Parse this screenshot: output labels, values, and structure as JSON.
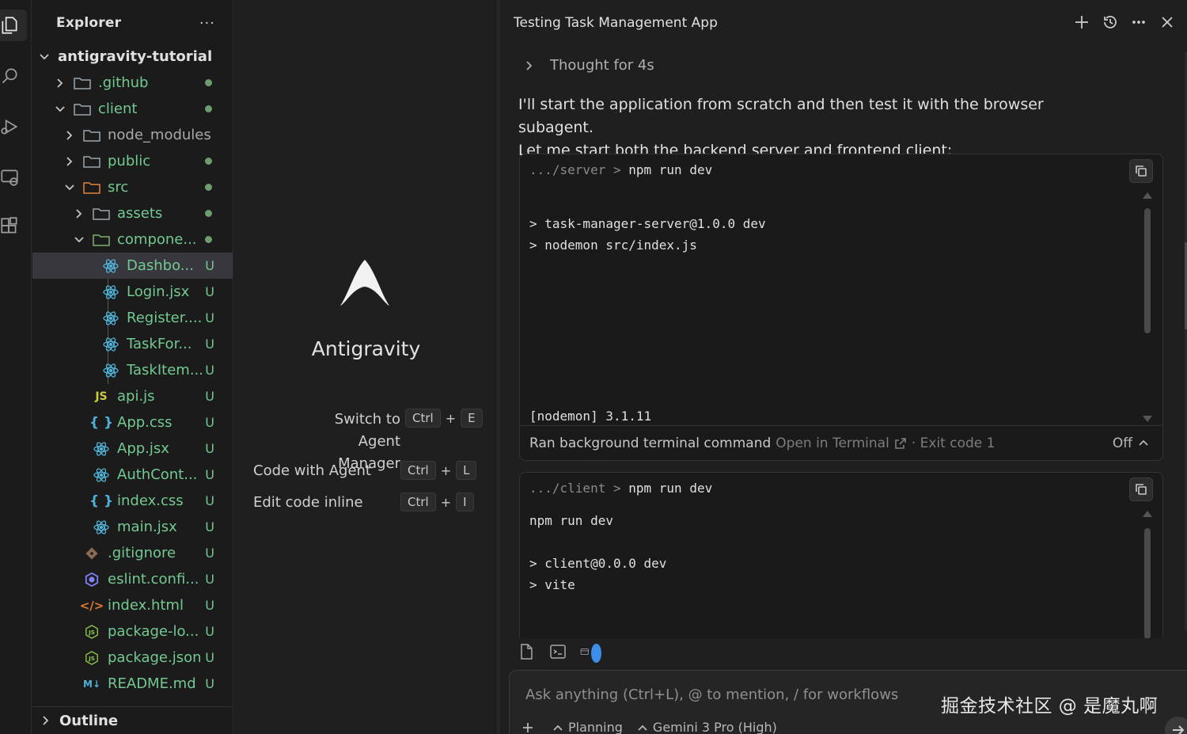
{
  "explorer": {
    "title": "Explorer",
    "more": "···",
    "root": "antigravity-tutorial",
    "items": [
      {
        "label": ".github",
        "badge": ""
      },
      {
        "label": "client",
        "badge": ""
      },
      {
        "label": "node_modules",
        "badge": ""
      },
      {
        "label": "public",
        "badge": ""
      },
      {
        "label": "src",
        "badge": ""
      },
      {
        "label": "assets",
        "badge": ""
      },
      {
        "label": "compone...",
        "badge": ""
      },
      {
        "label": "Dashbo...",
        "badge": "U"
      },
      {
        "label": "Login.jsx",
        "badge": "U"
      },
      {
        "label": "Register....",
        "badge": "U"
      },
      {
        "label": "TaskFor...",
        "badge": "U"
      },
      {
        "label": "TaskItem...",
        "badge": "U"
      },
      {
        "label": "api.js",
        "badge": "U"
      },
      {
        "label": "App.css",
        "badge": "U"
      },
      {
        "label": "App.jsx",
        "badge": "U"
      },
      {
        "label": "AuthCont...",
        "badge": "U"
      },
      {
        "label": "index.css",
        "badge": "U"
      },
      {
        "label": "main.jsx",
        "badge": "U"
      },
      {
        "label": ".gitignore",
        "badge": "U"
      },
      {
        "label": "eslint.confi...",
        "badge": "U"
      },
      {
        "label": "index.html",
        "badge": "U"
      },
      {
        "label": "package-lo...",
        "badge": "U"
      },
      {
        "label": "package.json",
        "badge": "U"
      },
      {
        "label": "README.md",
        "badge": "U"
      }
    ],
    "outline": "Outline"
  },
  "center": {
    "brand": "Antigravity",
    "shortcuts": [
      {
        "label_line1": "Switch to Agent",
        "label_line2": "Manager",
        "key1": "Ctrl",
        "plus": "+",
        "key2": "E"
      },
      {
        "label": "Code with Agent",
        "key1": "Ctrl",
        "plus": "+",
        "key2": "L"
      },
      {
        "label": "Edit code inline",
        "key1": "Ctrl",
        "plus": "+",
        "key2": "I"
      }
    ]
  },
  "chat": {
    "title": "Testing Task Management App",
    "thought": "Thought for 4s",
    "message_line1": "I'll start the application from scratch and then test it with the browser subagent.",
    "message_line2": "Let me start both the backend server and frontend client:",
    "terminal1": {
      "cwd": ".../server",
      "sep": ">",
      "command": "npm run dev",
      "lines": [
        "> task-manager-server@1.0.0 dev",
        "> nodemon src/index.js"
      ],
      "last_line": "[nodemon] 3.1.11",
      "footer_main": "Ran background terminal command",
      "footer_link": "Open in Terminal",
      "footer_exit": "· Exit code 1",
      "footer_toggle": "Off"
    },
    "terminal2": {
      "cwd": ".../client",
      "sep": ">",
      "command": "npm run dev",
      "lines": [
        "npm run dev",
        "",
        "> client@0.0.0 dev",
        "> vite"
      ]
    },
    "input_placeholder": "Ask anything (Ctrl+L), @ to mention, / for workflows",
    "mode": "Planning",
    "model": "Gemini 3 Pro (High)"
  },
  "watermark": "掘金技术社区 @ 是魔丸啊",
  "colors": {
    "untracked": "#73c991",
    "accent": "#3b8eea",
    "background": "#1f1f1f"
  }
}
